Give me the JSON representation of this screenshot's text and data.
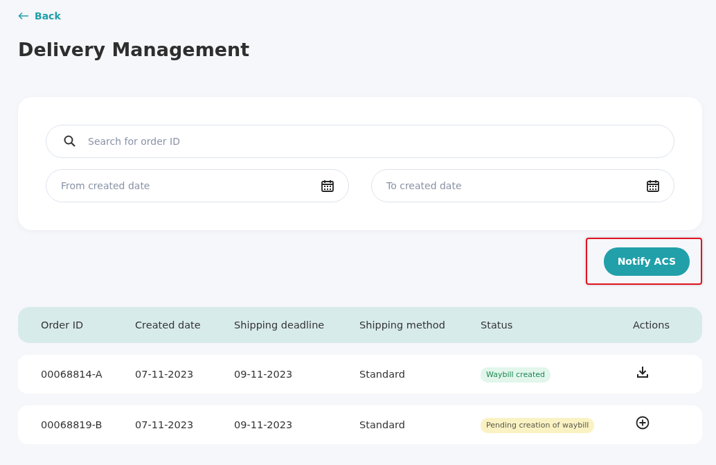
{
  "back_link": {
    "label": "Back"
  },
  "title": "Delivery Management",
  "filters": {
    "search": {
      "placeholder": "Search for order ID"
    },
    "dates": [
      {
        "placeholder": "From created date"
      },
      {
        "placeholder": "To created date"
      }
    ]
  },
  "notify_button": {
    "label": "Notify ACS",
    "highlighted": true
  },
  "table": {
    "columns": [
      "Order ID",
      "Created date",
      "Shipping deadline",
      "Shipping method",
      "Status",
      "Actions"
    ],
    "rows": [
      {
        "order_id": "00068814-A",
        "created": "07-11-2023",
        "deadline": "09-11-2023",
        "method": "Standard",
        "status": {
          "label": "Waybill created",
          "kind": "done"
        },
        "action": {
          "kind": "download"
        }
      },
      {
        "order_id": "00068819-B",
        "created": "07-11-2023",
        "deadline": "09-11-2023",
        "method": "Standard",
        "status": {
          "label": "Pending creation of waybill",
          "kind": "pending"
        },
        "action": {
          "kind": "add"
        }
      }
    ]
  }
}
